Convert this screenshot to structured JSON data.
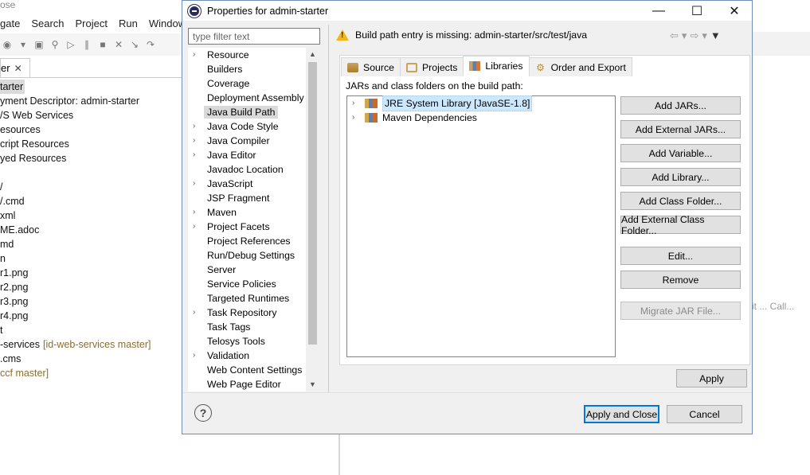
{
  "background": {
    "title_fragment": "ose",
    "menus": [
      "gate",
      "Search",
      "Project",
      "Run",
      "Window"
    ],
    "view_tab": "er",
    "tree": [
      {
        "text": "tarter",
        "selected": true
      },
      {
        "text": "yment Descriptor: admin-starter"
      },
      {
        "text": "/S Web Services"
      },
      {
        "text": "esources"
      },
      {
        "text": "cript Resources"
      },
      {
        "text": "yed Resources"
      },
      {
        "text": ""
      },
      {
        "text": "/"
      },
      {
        "text": "/.cmd"
      },
      {
        "text": "xml"
      },
      {
        "text": "ME.adoc"
      },
      {
        "text": "md"
      },
      {
        "text": "n"
      },
      {
        "text": "r1.png"
      },
      {
        "text": "r2.png"
      },
      {
        "text": "r3.png"
      },
      {
        "text": "r4.png"
      },
      {
        "text": "t"
      },
      {
        "text": "-services",
        "repo": "[id-web-services master]"
      },
      {
        "text": ".cms"
      },
      {
        "text": "",
        "repo": "ccf master]"
      }
    ],
    "right_tab": "it ...   Call..."
  },
  "dialog": {
    "title": "Properties for admin-starter",
    "filter_placeholder": "type filter text",
    "nav_items": [
      {
        "label": "Resource",
        "expandable": true
      },
      {
        "label": "Builders",
        "expandable": false
      },
      {
        "label": "Coverage",
        "expandable": false
      },
      {
        "label": "Deployment Assembly",
        "expandable": false
      },
      {
        "label": "Java Build Path",
        "expandable": false,
        "selected": true
      },
      {
        "label": "Java Code Style",
        "expandable": true
      },
      {
        "label": "Java Compiler",
        "expandable": true
      },
      {
        "label": "Java Editor",
        "expandable": true
      },
      {
        "label": "Javadoc Location",
        "expandable": false
      },
      {
        "label": "JavaScript",
        "expandable": true
      },
      {
        "label": "JSP Fragment",
        "expandable": false
      },
      {
        "label": "Maven",
        "expandable": true
      },
      {
        "label": "Project Facets",
        "expandable": true
      },
      {
        "label": "Project References",
        "expandable": false
      },
      {
        "label": "Run/Debug Settings",
        "expandable": false
      },
      {
        "label": "Server",
        "expandable": false
      },
      {
        "label": "Service Policies",
        "expandable": false
      },
      {
        "label": "Targeted Runtimes",
        "expandable": false
      },
      {
        "label": "Task Repository",
        "expandable": true
      },
      {
        "label": "Task Tags",
        "expandable": false
      },
      {
        "label": "Telosys Tools",
        "expandable": false
      },
      {
        "label": "Validation",
        "expandable": true
      },
      {
        "label": "Web Content Settings",
        "expandable": false
      },
      {
        "label": "Web Page Editor",
        "expandable": false
      }
    ],
    "header_message": "Build path entry is missing: admin-starter/src/test/java",
    "tabs": [
      "Source",
      "Projects",
      "Libraries",
      "Order and Export"
    ],
    "active_tab": "Libraries",
    "section_label": "JARs and class folders on the build path:",
    "libraries": [
      {
        "label": "JRE System Library [JavaSE-1.8]",
        "selected": true
      },
      {
        "label": "Maven Dependencies",
        "selected": false
      }
    ],
    "side_buttons": {
      "add_jars": "Add JARs...",
      "add_external_jars": "Add External JARs...",
      "add_variable": "Add Variable...",
      "add_library": "Add Library...",
      "add_class_folder": "Add Class Folder...",
      "add_external_class_folder": "Add External Class Folder...",
      "edit": "Edit...",
      "remove": "Remove",
      "migrate_jar": "Migrate JAR File..."
    },
    "apply": "Apply",
    "apply_and_close": "Apply and Close",
    "cancel": "Cancel"
  },
  "colors": {
    "selection": "#cce8ff",
    "warning": "#f2b51a",
    "dialog_border": "#6f8fb4",
    "repo_text": "#8b6d2e"
  }
}
